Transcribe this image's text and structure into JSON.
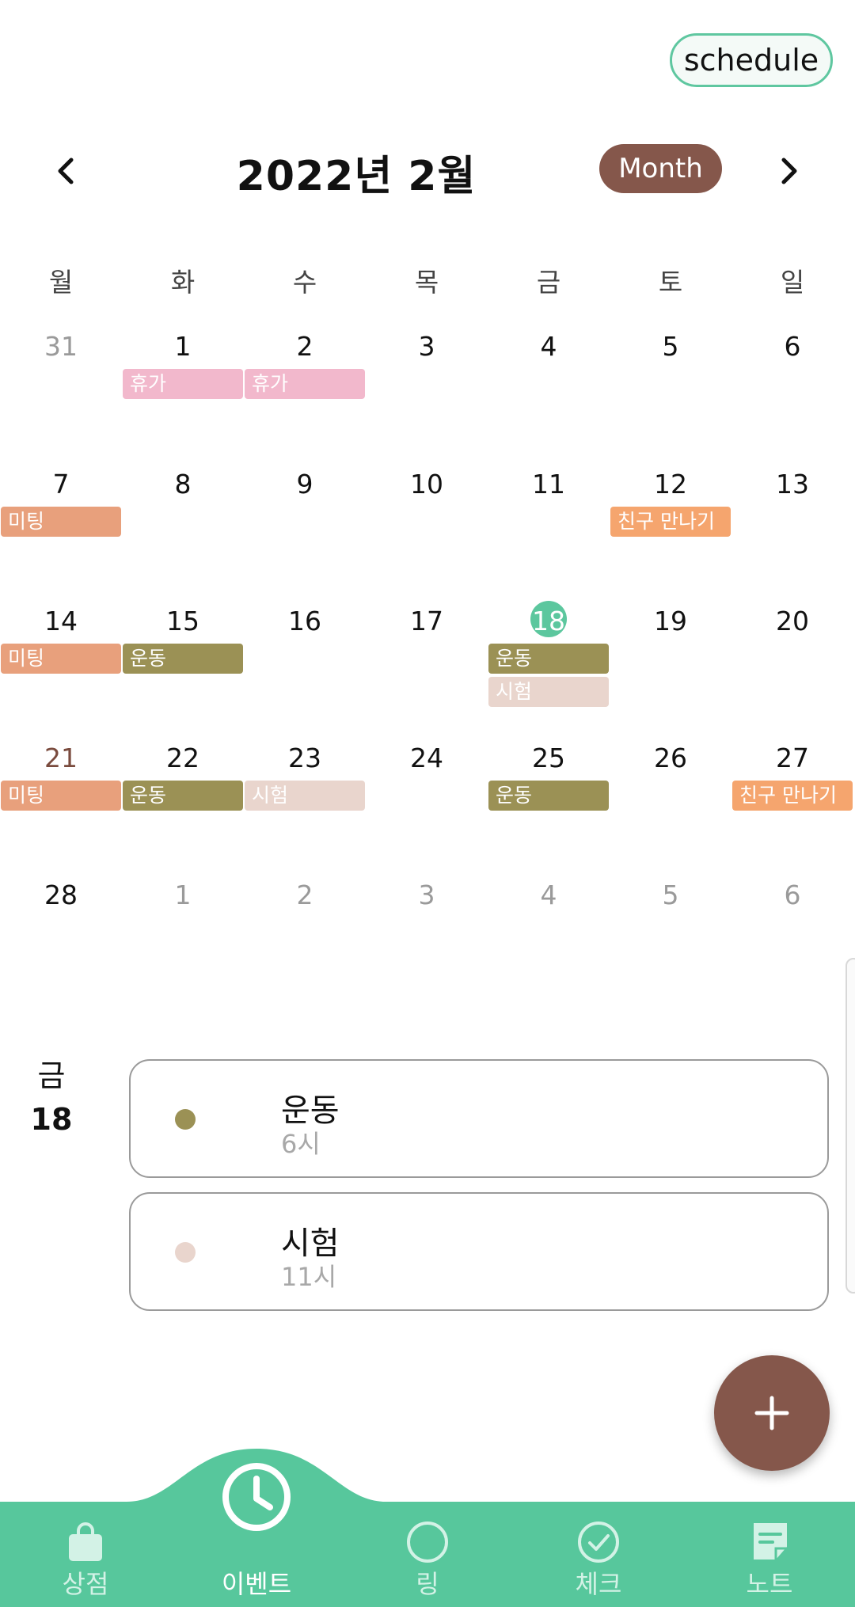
{
  "header": {
    "schedule_label": "schedule",
    "month_title": "2022년 2월",
    "view_mode_label": "Month",
    "prev_icon": "chevron-left-icon",
    "next_icon": "chevron-right-icon"
  },
  "calendar": {
    "weekdays": [
      "월",
      "화",
      "수",
      "목",
      "금",
      "토",
      "일"
    ],
    "weeks": [
      [
        "31",
        "1",
        "2",
        "3",
        "4",
        "5",
        "6"
      ],
      [
        "7",
        "8",
        "9",
        "10",
        "11",
        "12",
        "13"
      ],
      [
        "14",
        "15",
        "16",
        "17",
        "18",
        "19",
        "20"
      ],
      [
        "21",
        "22",
        "23",
        "24",
        "25",
        "26",
        "27"
      ],
      [
        "28",
        "1",
        "2",
        "3",
        "4",
        "5",
        "6"
      ]
    ],
    "today": "18",
    "events": [
      {
        "label": "휴가",
        "week": 0,
        "day": 1,
        "row": 0,
        "color": "#f2b8cc"
      },
      {
        "label": "휴가",
        "week": 0,
        "day": 2,
        "row": 0,
        "color": "#f2b8cc"
      },
      {
        "label": "미팅",
        "week": 1,
        "day": 0,
        "row": 0,
        "color": "#e8a07c"
      },
      {
        "label": "친구 만나기",
        "week": 1,
        "day": 5,
        "row": 0,
        "color": "#f5a56e"
      },
      {
        "label": "미팅",
        "week": 2,
        "day": 0,
        "row": 0,
        "color": "#e8a07c"
      },
      {
        "label": "운동",
        "week": 2,
        "day": 1,
        "row": 0,
        "color": "#9b9155"
      },
      {
        "label": "운동",
        "week": 2,
        "day": 4,
        "row": 0,
        "color": "#9b9155"
      },
      {
        "label": "시험",
        "week": 2,
        "day": 4,
        "row": 1,
        "color": "#e9d5cd"
      },
      {
        "label": "미팅",
        "week": 3,
        "day": 0,
        "row": 0,
        "color": "#e8a07c"
      },
      {
        "label": "운동",
        "week": 3,
        "day": 1,
        "row": 0,
        "color": "#9b9155"
      },
      {
        "label": "시험",
        "week": 3,
        "day": 2,
        "row": 0,
        "color": "#e9d5cd"
      },
      {
        "label": "운동",
        "week": 3,
        "day": 4,
        "row": 0,
        "color": "#9b9155"
      },
      {
        "label": "친구 만나기",
        "week": 3,
        "day": 6,
        "row": 0,
        "color": "#f5a56e"
      }
    ]
  },
  "selected_day": {
    "weekday": "금",
    "day": "18",
    "events": [
      {
        "name": "운동",
        "time": "6시",
        "color": "#9b9155"
      },
      {
        "name": "시험",
        "time": "11시",
        "color": "#e9d5cd"
      }
    ]
  },
  "fab": {
    "icon": "plus-icon"
  },
  "bottom_nav": {
    "items": [
      {
        "label": "상점",
        "icon": "shopping-bag-icon"
      },
      {
        "label": "이벤트",
        "icon": "clock-icon"
      },
      {
        "label": "링",
        "icon": "circle-icon"
      },
      {
        "label": "체크",
        "icon": "check-circle-icon"
      },
      {
        "label": "노트",
        "icon": "note-icon"
      }
    ],
    "active_index": 1
  },
  "colors": {
    "accent_green": "#5cc79e",
    "brown": "#85574b",
    "nav_bg": "#57c79c"
  }
}
